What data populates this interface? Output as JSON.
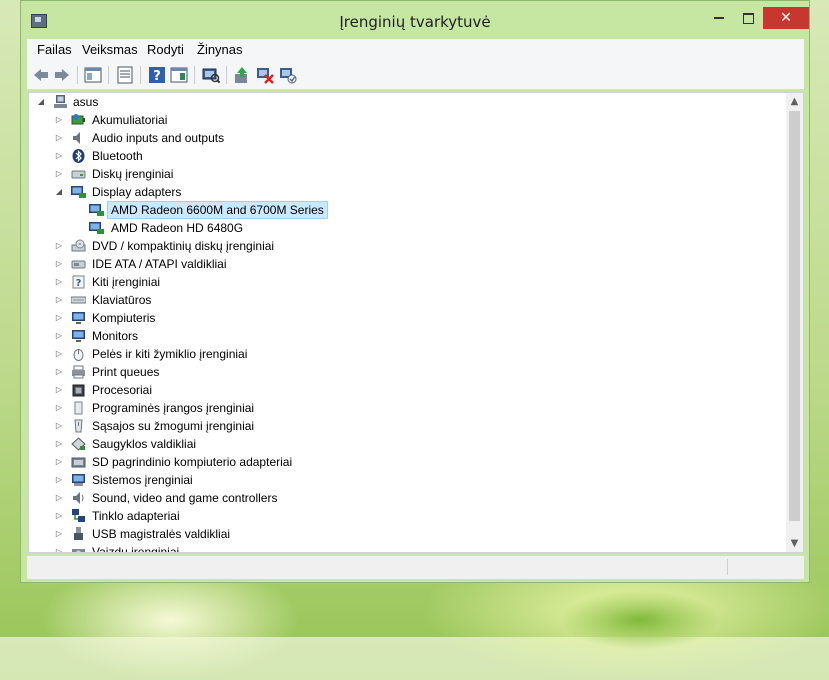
{
  "window": {
    "title": "Įrenginių tvarkytuvė",
    "close_glyph": "✕",
    "min_icon": "minimize-icon",
    "max_icon": "maximize-icon"
  },
  "menu": [
    {
      "label": "Failas"
    },
    {
      "label": "Veiksmas"
    },
    {
      "label": "Rodyti"
    },
    {
      "label": "Žinynas"
    }
  ],
  "toolbar": [
    {
      "icon": "back-arrow-icon"
    },
    {
      "icon": "forward-arrow-icon"
    },
    {
      "icon": "show-hide-console-tree-icon"
    },
    {
      "icon": "properties-icon"
    },
    {
      "icon": "help-icon"
    },
    {
      "icon": "action-pane-icon"
    },
    {
      "icon": "scan-hardware-icon"
    },
    {
      "icon": "update-driver-icon"
    },
    {
      "icon": "uninstall-device-icon"
    },
    {
      "icon": "enable-device-icon"
    }
  ],
  "tree": {
    "root": "asus",
    "root_arrow": "◢",
    "collapsed_arrow": "▷",
    "expanded_arrow": "◢",
    "items": [
      {
        "label": "Akumuliatoriai",
        "icon": "battery-icon"
      },
      {
        "label": "Audio inputs and outputs",
        "icon": "speaker-icon"
      },
      {
        "label": "Bluetooth",
        "icon": "bluetooth-icon"
      },
      {
        "label": "Diskų įrenginiai",
        "icon": "disk-drive-icon"
      },
      {
        "label": "Display adapters",
        "icon": "display-adapter-icon",
        "expanded": true,
        "children": [
          {
            "label": "AMD Radeon 6600M and 6700M Series",
            "selected": true
          },
          {
            "label": "AMD Radeon HD 6480G"
          }
        ]
      },
      {
        "label": "DVD / kompaktinių diskų įrenginiai",
        "icon": "dvd-drive-icon"
      },
      {
        "label": "IDE ATA / ATAPI valdikliai",
        "icon": "ide-controller-icon"
      },
      {
        "label": "Kiti įrenginiai",
        "icon": "unknown-device-icon"
      },
      {
        "label": "Klaviatūros",
        "icon": "keyboard-icon"
      },
      {
        "label": "Kompiuteris",
        "icon": "computer-icon"
      },
      {
        "label": "Monitors",
        "icon": "monitor-icon"
      },
      {
        "label": "Pelės ir kiti žymiklio įrenginiai",
        "icon": "mouse-icon"
      },
      {
        "label": "Print queues",
        "icon": "printer-icon"
      },
      {
        "label": "Procesoriai",
        "icon": "processor-icon"
      },
      {
        "label": "Programinės įrangos įrenginiai",
        "icon": "software-device-icon"
      },
      {
        "label": "Sąsajos su žmogumi įrenginiai",
        "icon": "hid-icon"
      },
      {
        "label": "Saugyklos valdikliai",
        "icon": "storage-controller-icon"
      },
      {
        "label": "SD pagrindinio kompiuterio adapteriai",
        "icon": "sd-adapter-icon"
      },
      {
        "label": "Sistemos įrenginiai",
        "icon": "system-device-icon"
      },
      {
        "label": "Sound, video and game controllers",
        "icon": "sound-controller-icon"
      },
      {
        "label": "Tinklo adapteriai",
        "icon": "network-adapter-icon"
      },
      {
        "label": "USB magistralės valdikliai",
        "icon": "usb-controller-icon"
      },
      {
        "label": "Vaizdų įrenginiai",
        "icon": "imaging-device-icon"
      }
    ]
  },
  "scrollbar": {
    "up": "▲",
    "down": "▼"
  },
  "colors": {
    "selection_bg": "#cce8ff",
    "selection_border": "#99d1ff",
    "close_button": "#c7372f",
    "window_frame": "#c5e7a2"
  }
}
